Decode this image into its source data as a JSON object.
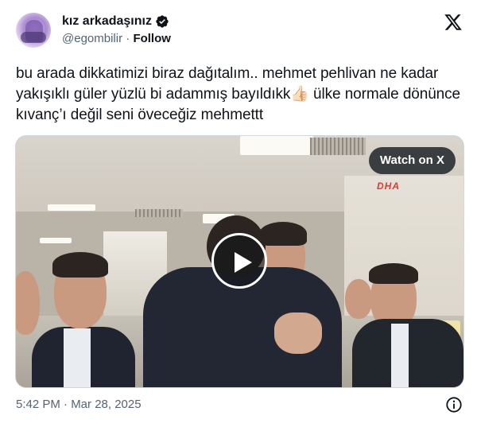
{
  "author": {
    "display_name": "kız arkadaşınız",
    "handle": "@egombilir",
    "separator": "·",
    "follow_label": "Follow",
    "verified": true
  },
  "tweet": {
    "text": "bu arada dikkatimizi biraz dağıtalım..  mehmet pehlivan ne kadar yakışıklı güler yüzlü bi adammış bayıldıkk👍🏻 ülke normale dönünce kıvanç’ı değil seni öveceğiz mehmettt"
  },
  "media": {
    "watch_label": "Watch on X",
    "watermark": "DHA",
    "type": "video"
  },
  "footer": {
    "timestamp": "5:42 PM · Mar 28, 2025"
  },
  "icons": {
    "verified": "verified-badge-icon",
    "logo": "x-logo-icon",
    "play": "play-icon",
    "info": "info-icon"
  },
  "colors": {
    "text": "#0f1419",
    "secondary": "#536471",
    "border": "#cfd9de",
    "watermark": "#e03a2e"
  }
}
